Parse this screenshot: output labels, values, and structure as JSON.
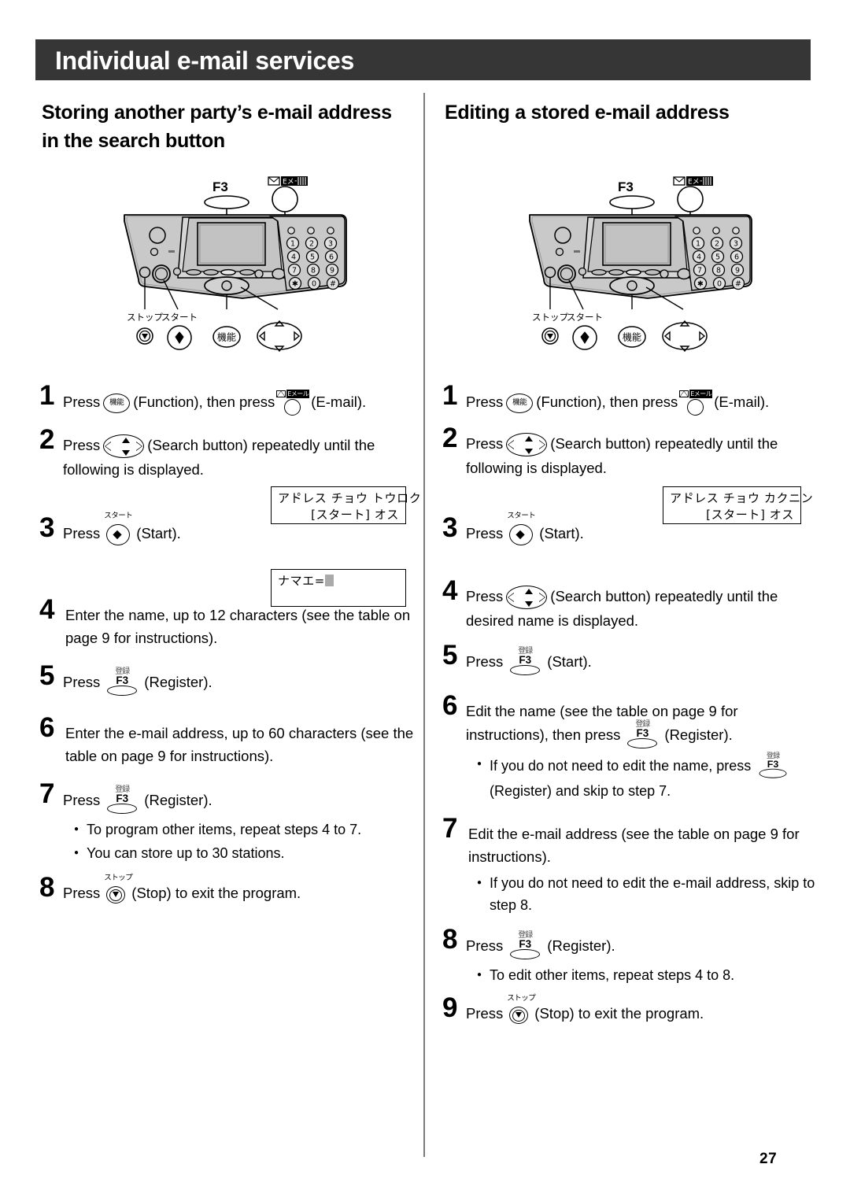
{
  "banner": {
    "title": "Individual e-mail services"
  },
  "sections": {
    "left_heading": "Storing another party’s e-mail address in the search button",
    "right_heading": "Editing a stored e-mail address"
  },
  "panel": {
    "callouts": {
      "f3": "F3",
      "email_label": "Eメール",
      "stop": "ストップ",
      "start": "スタート",
      "function": "機能"
    },
    "keypad": [
      "1",
      "2",
      "3",
      "4",
      "5",
      "6",
      "7",
      "8",
      "9",
      "✱",
      "0",
      "#"
    ]
  },
  "buttons": {
    "function_kanji": "機能",
    "start_kana": "スタート",
    "stop_kana": "ストップ",
    "f3_kanji": "登録",
    "f3_label": "F3",
    "email_label": "Eメール"
  },
  "lcd": {
    "left_1": {
      "line1": "アト゚レス チョウ トウロク",
      "line2": "[スタート] オス"
    },
    "left_2": {
      "line1": "ナマエ=",
      "line2": ""
    },
    "right_1": {
      "line1": "アト゚レス チョウ カクニン",
      "line2": "[スタート] オス"
    }
  },
  "left_steps": [
    {
      "num": "1",
      "pre": "Press",
      "mid": "(Function), then press",
      "post": "(E-mail).",
      "icons": [
        "function",
        "email"
      ]
    },
    {
      "num": "2",
      "pre": "Press",
      "mid": "(Search button) repeatedly until the following is displayed.",
      "icons": [
        "nav"
      ]
    },
    {
      "num": "3",
      "pre": "Press",
      "mid": "(Start).",
      "icons": [
        "start"
      ]
    },
    {
      "num": "4",
      "text": "Enter the name, up to 12 characters (see the table on page 9 for instructions)."
    },
    {
      "num": "5",
      "pre": "Press",
      "mid": "(Register).",
      "icons": [
        "f3"
      ]
    },
    {
      "num": "6",
      "text": "Enter the e-mail address, up to 60 characters (see the table on page 9 for instructions)."
    },
    {
      "num": "7",
      "pre": "Press",
      "mid": "(Register).",
      "icons": [
        "f3"
      ],
      "bullets": [
        "To program other items, repeat steps 4 to 7.",
        "You can store up to 30 stations."
      ]
    },
    {
      "num": "8",
      "pre": "Press",
      "mid": "(Stop) to exit the program.",
      "icons": [
        "stop"
      ]
    }
  ],
  "right_steps": [
    {
      "num": "1",
      "pre": "Press",
      "mid": "(Function), then press",
      "post": "(E-mail).",
      "icons": [
        "function",
        "email"
      ]
    },
    {
      "num": "2",
      "pre": "Press",
      "mid": "(Search button) repeatedly until the following is displayed.",
      "icons": [
        "nav"
      ]
    },
    {
      "num": "3",
      "pre": "Press",
      "mid": "(Start).",
      "icons": [
        "start"
      ]
    },
    {
      "num": "4",
      "pre": "Press",
      "mid": "(Search button) repeatedly until the desired name is displayed.",
      "icons": [
        "nav"
      ]
    },
    {
      "num": "5",
      "pre": "Press",
      "mid": "(Start).",
      "icons": [
        "f3"
      ]
    },
    {
      "num": "6",
      "pre": "Edit the name (see the table on page 9 for instructions), then press",
      "mid": "(Register).",
      "icons": [
        "f3"
      ],
      "bullet_pre": "If you do not need to edit the name, press",
      "bullet_post": "(Register) and skip to step 7."
    },
    {
      "num": "7",
      "text": "Edit the e-mail address (see the table on page 9 for instructions).",
      "bullets": [
        "If you do not need to edit the e-mail address, skip to step 8."
      ]
    },
    {
      "num": "8",
      "pre": "Press",
      "mid": "(Register).",
      "icons": [
        "f3"
      ],
      "bullets": [
        "To edit other items, repeat steps 4 to 8."
      ]
    },
    {
      "num": "9",
      "pre": "Press",
      "mid": "(Stop) to exit the program.",
      "icons": [
        "stop"
      ]
    }
  ],
  "footer": {
    "page_number": "27"
  },
  "colors": {
    "banner_bg": "#363636",
    "banner_text": "#ffffff",
    "divider": "#7a7a7a",
    "panel_body": "#c9c9c9",
    "lcd_screen": "#b9b9b9"
  }
}
